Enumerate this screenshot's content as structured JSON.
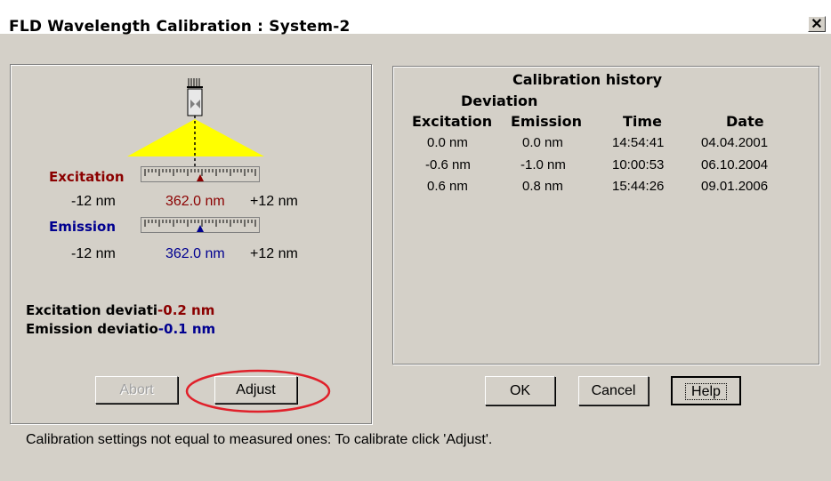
{
  "window": {
    "title": "FLD Wavelength Calibration : System-2",
    "close_glyph": "✕"
  },
  "left": {
    "excitation": {
      "label": "Excitation",
      "min": "-12 nm",
      "value": "362.0 nm",
      "max": "+12 nm"
    },
    "emission": {
      "label": "Emission",
      "min": "-12 nm",
      "value": "362.0 nm",
      "max": "+12 nm"
    },
    "excitation_dev": {
      "label": "Excitation deviati",
      "value": "-0.2 nm"
    },
    "emission_dev": {
      "label": "Emission deviatio",
      "value": "-0.1 nm"
    },
    "abort_label": "Abort",
    "adjust_label": "Adjust"
  },
  "history": {
    "title": "Calibration history",
    "deviation_label": "Deviation",
    "columns": [
      "Excitation",
      "Emission",
      "Time",
      "Date"
    ],
    "rows": [
      [
        "0.0 nm",
        "0.0 nm",
        "14:54:41",
        "04.04.2001"
      ],
      [
        "-0.6 nm",
        "-1.0 nm",
        "10:00:53",
        "06.10.2004"
      ],
      [
        "0.6 nm",
        "0.8 nm",
        "15:44:26",
        "09.01.2006"
      ]
    ]
  },
  "buttons": {
    "ok": "OK",
    "cancel": "Cancel",
    "help": "Help"
  },
  "status": "Calibration settings not equal to measured ones: To calibrate click 'Adjust'.",
  "colors": {
    "excitation": "#8b0000",
    "emission": "#000090",
    "highlight_circle": "#e0202a",
    "beam": "#ffff00"
  }
}
